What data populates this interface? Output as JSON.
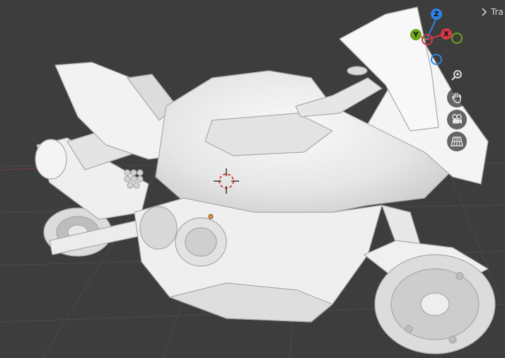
{
  "sidebar": {
    "tab_label": "Tra"
  },
  "gizmo": {
    "z_label": "Z",
    "y_label": "Y",
    "x_label": "X",
    "colors": {
      "x": "#d6384b",
      "y": "#6ca21d",
      "z": "#2f83e6"
    }
  },
  "navigation": {
    "buttons": [
      {
        "name": "zoom",
        "icon": "zoom-icon"
      },
      {
        "name": "pan",
        "icon": "hand-icon"
      },
      {
        "name": "camera-view",
        "icon": "camera-icon"
      },
      {
        "name": "perspective-toggle",
        "icon": "grid-icon"
      }
    ]
  },
  "scene": {
    "object": "motorcycle-model",
    "shading": "solid",
    "background": "#3d3d3d"
  }
}
